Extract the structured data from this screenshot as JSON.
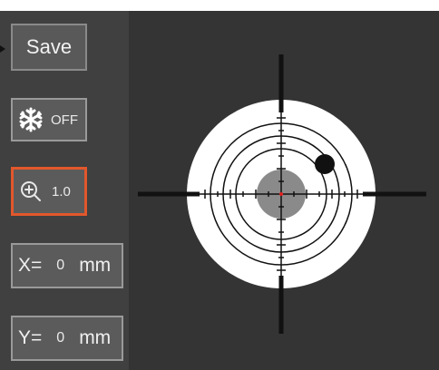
{
  "toolbar": {
    "save_label": "Save",
    "freeze": {
      "icon": "snowflake-icon",
      "state_label": "OFF"
    },
    "zoom": {
      "icon": "zoom-in-icon",
      "value": "1.0",
      "accent": "#e2572c"
    },
    "x_offset": {
      "label": "X=",
      "value": "0",
      "unit": "mm"
    },
    "y_offset": {
      "label": "Y=",
      "value": "0",
      "unit": "mm"
    }
  },
  "colors": {
    "panel_bg": "#404040",
    "view_bg": "#343434",
    "button_bg": "#5b5b5b",
    "button_border": "#9a9a9a",
    "active_border": "#e2572c",
    "target_white": "#ffffff",
    "target_center": "#8a8a8a",
    "reticle": "#111111",
    "center_dot": "#e02020"
  }
}
